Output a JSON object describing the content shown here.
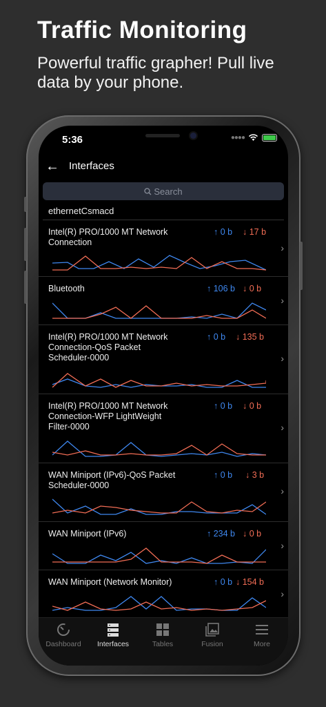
{
  "hero": {
    "title": "Traffic Monitoring",
    "subtitle": "Powerful traffic grapher! Pull live data by your phone."
  },
  "status_bar": {
    "time": "5:36",
    "battery_color": "#3ec94a"
  },
  "navbar": {
    "title": "Interfaces",
    "back_icon": "arrow-left-icon"
  },
  "search": {
    "placeholder": "Search"
  },
  "section": {
    "title": "ethernetCsmacd"
  },
  "colors": {
    "upload": "#3f88f0",
    "download": "#f26d55"
  },
  "interfaces": [
    {
      "name": "Intel(R) PRO/1000 MT Network Connection",
      "up": "↑ 0 b",
      "down": "↓ 17 b"
    },
    {
      "name": "Bluetooth",
      "up": "↑ 106 b",
      "down": "↓ 0 b"
    },
    {
      "name": "Intel(R) PRO/1000 MT Network Connection-QoS Packet Scheduler-0000",
      "up": "↑ 0 b",
      "down": "↓ 135 b"
    },
    {
      "name": "Intel(R) PRO/1000 MT Network Connection-WFP LightWeight Filter-0000",
      "up": "↑ 0 b",
      "down": "↓ 0 b"
    },
    {
      "name": "WAN Miniport (IPv6)-QoS Packet Scheduler-0000",
      "up": "↑ 0 b",
      "down": "↓ 3 b"
    },
    {
      "name": "WAN Miniport (IPv6)",
      "up": "↑ 234 b",
      "down": "↓ 0 b"
    },
    {
      "name": "WAN Miniport (Network Monitor)",
      "up": "↑ 0 b",
      "down": "↓ 154 b"
    }
  ],
  "tabs": [
    {
      "label": "Dashboard",
      "icon": "speedometer-icon",
      "active": false
    },
    {
      "label": "Interfaces",
      "icon": "server-stack-icon",
      "active": true
    },
    {
      "label": "Tables",
      "icon": "grid-icon",
      "active": false
    },
    {
      "label": "Fusion",
      "icon": "photo-stack-icon",
      "active": false
    },
    {
      "label": "More",
      "icon": "menu-icon",
      "active": false
    }
  ]
}
